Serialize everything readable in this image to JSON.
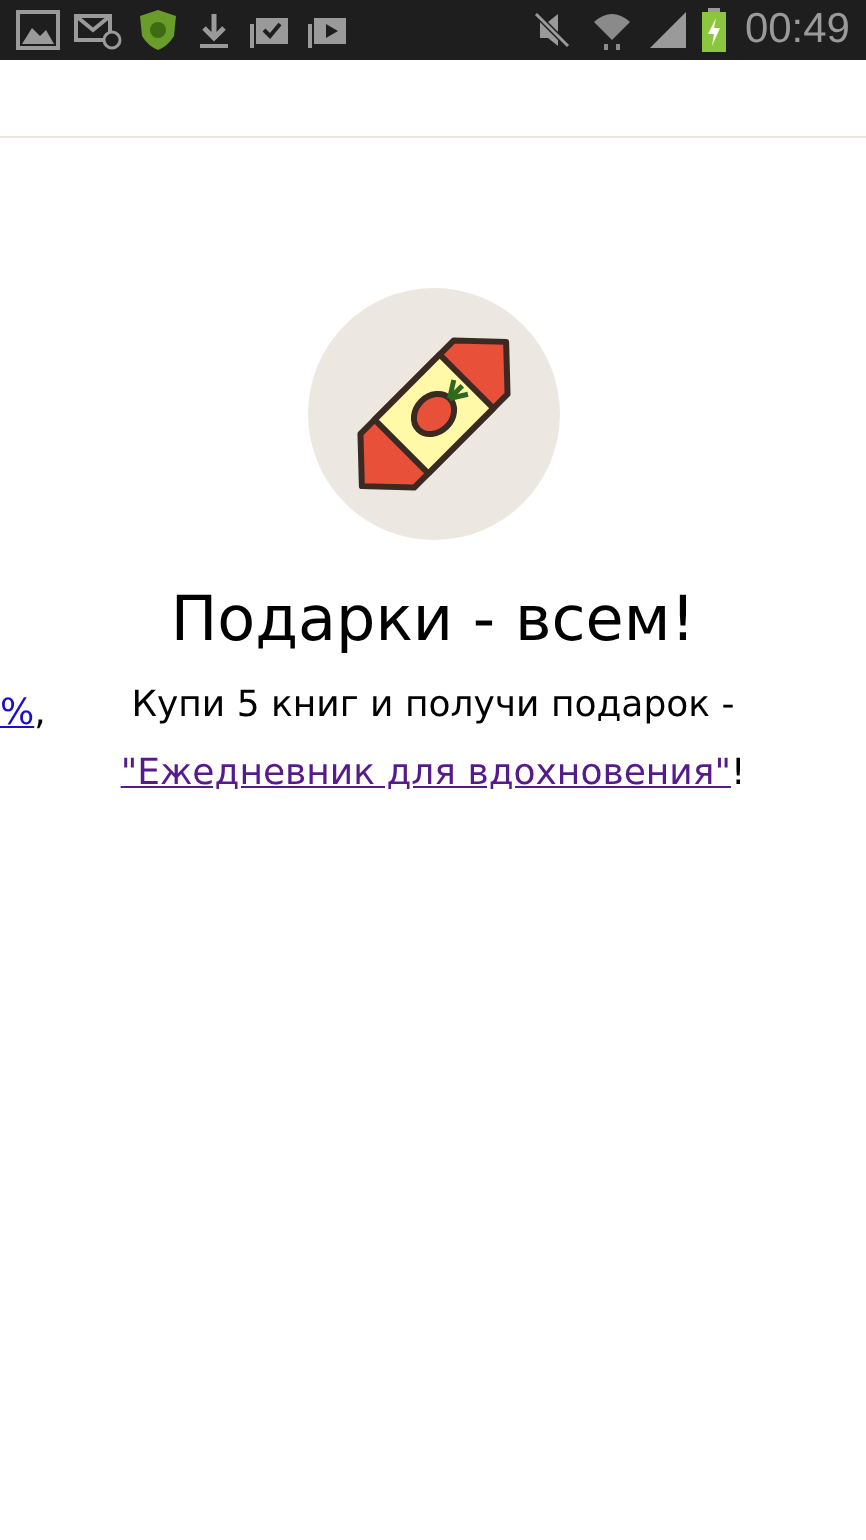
{
  "status_bar": {
    "time": "00:49",
    "battery_charging": true
  },
  "previous_slide": {
    "link": "%",
    "tail": ","
  },
  "promo": {
    "title": "Подарки - всем!",
    "text": "Купи 5 книг и получи подарок -",
    "link": "\"Ежедневник для вдохновения\"",
    "link_tail": "!"
  }
}
